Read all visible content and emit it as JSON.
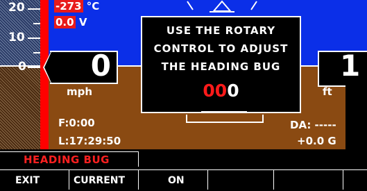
{
  "speed_tape": {
    "tick_20": "20",
    "tick_10": "10",
    "tick_0": "0",
    "temperature": "-273",
    "temperature_unit": "°C",
    "voltage": "0.0",
    "voltage_unit": "V"
  },
  "airspeed": {
    "value": "0",
    "unit": "mph"
  },
  "altitude": {
    "value": "1",
    "unit": "ft"
  },
  "fuel": {
    "label": "F:0:00"
  },
  "clock": {
    "label": "L:17:29:50"
  },
  "density_altitude": {
    "label": "DA: -----"
  },
  "g_meter": {
    "value": "+0.0",
    "unit": "G"
  },
  "dialog": {
    "line1": "USE THE ROTARY",
    "line2": "CONTROL TO ADJUST",
    "line3": "THE HEADING BUG",
    "heading_red": "00",
    "heading_white": "0"
  },
  "mode_title": "HEADING BUG",
  "softkeys": [
    "EXIT",
    "CURRENT",
    "ON",
    "",
    "",
    ""
  ],
  "colors": {
    "sky": "#0b2fe8",
    "ground": "#8a4a12",
    "alert_red": "#ff1a1a"
  }
}
